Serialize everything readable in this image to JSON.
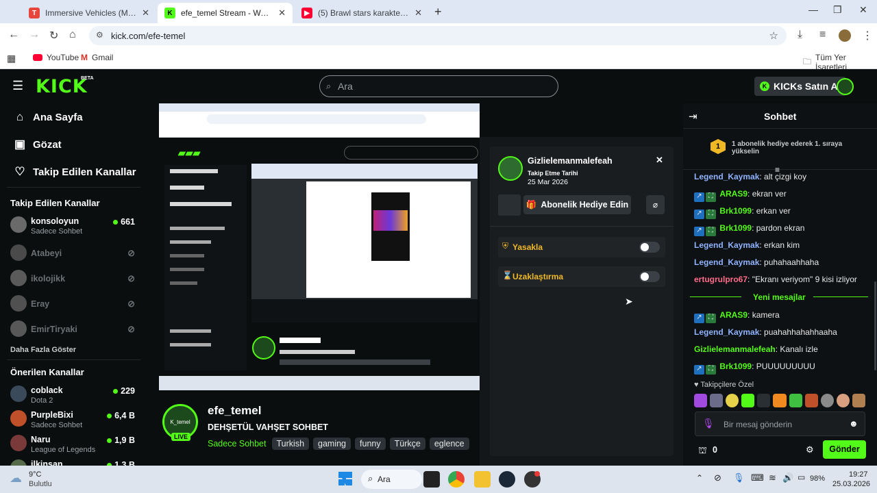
{
  "browser": {
    "tabs": [
      {
        "title": "Immersive Vehicles (MTS/IV) - C",
        "active": false
      },
      {
        "title": "efe_temel Stream - Watch Live o",
        "active": true
      },
      {
        "title": "(5) Brawl stars karakterleriyle şe",
        "active": false
      }
    ],
    "new_tab": "+",
    "url": "kick.com/efe-temel",
    "bookmarks": [
      {
        "label": "YouTube"
      },
      {
        "label": "Gmail"
      }
    ],
    "all_bookmarks": "Tüm Yer İşaretleri"
  },
  "kick": {
    "logo": "KICK",
    "beta": "BETA",
    "search_placeholder": "Ara",
    "buy_kicks": "KICKs Satın Al",
    "nav": [
      {
        "label": "Ana Sayfa",
        "icon": "home-icon"
      },
      {
        "label": "Gözat",
        "icon": "browse-icon"
      },
      {
        "label": "Takip Edilen Kanallar",
        "icon": "heart-icon"
      }
    ],
    "followed_heading": "Takip Edilen Kanallar",
    "followed": [
      {
        "name": "konsoloyun",
        "sub": "Sadece Sohbet",
        "count": "661",
        "live": true
      },
      {
        "name": "Atabeyi",
        "sub": "",
        "count": "",
        "live": false
      },
      {
        "name": "ikolojikk",
        "sub": "",
        "count": "",
        "live": false
      },
      {
        "name": "Eray",
        "sub": "",
        "count": "",
        "live": false
      },
      {
        "name": "EmirTiryaki",
        "sub": "",
        "count": "",
        "live": false
      }
    ],
    "show_more": "Daha Fazla Göster",
    "recommended_heading": "Önerilen Kanallar",
    "recommended": [
      {
        "name": "coblack",
        "sub": "Dota 2",
        "count": "229"
      },
      {
        "name": "PurpleBixi",
        "sub": "Sadece Sohbet",
        "count": "6,4 B"
      },
      {
        "name": "Naru",
        "sub": "League of Legends",
        "count": "1,9 B"
      },
      {
        "name": "ilkinsan",
        "sub": "",
        "count": "1,3 B"
      }
    ]
  },
  "stream": {
    "channel": "efe_temel",
    "avatar_text": "K_temel",
    "live": "LIVE",
    "title": "DEHŞETÜL VAHŞET SOHBET",
    "category": "Sadece Sohbet",
    "tags": [
      "Turkish",
      "gaming",
      "funny",
      "Türkçe",
      "eglence"
    ]
  },
  "user_card": {
    "username": "Gizlielemanmalefeah",
    "follow_label": "Takip Etme Tarihi",
    "follow_date": "25 Mar 2026",
    "gift_button": "Abonelik Hediye Edin",
    "ban_label": "Yasakla",
    "timeout_label": "Uzaklaştırma",
    "close": "✕"
  },
  "chat": {
    "title": "Sohbet",
    "top_gifter_rank": "1",
    "top_gifter_text": "1 abonelik hediye ederek 1. sıraya yükselin",
    "messages": [
      {
        "user": "Legend_Kaymak",
        "color": "#8fb3ff",
        "text": "alt çizgi koy",
        "badges": false
      },
      {
        "user": "ARAS9",
        "color": "#53fc18",
        "text": "ekran ver",
        "badges": true
      },
      {
        "user": "Brk1099",
        "color": "#53fc18",
        "text": "erkan ver",
        "badges": true
      },
      {
        "user": "Brk1099",
        "color": "#53fc18",
        "text": "pardon ekran",
        "badges": true
      },
      {
        "user": "Legend_Kaymak",
        "color": "#8fb3ff",
        "text": "erkan kim",
        "badges": false
      },
      {
        "user": "Legend_Kaymak",
        "color": "#8fb3ff",
        "text": "puhahaahhaha",
        "badges": false
      },
      {
        "user": "ertugrulpro67",
        "color": "#ff6b8a",
        "text": "\"Ekranı veriyom\" 9 kisi izliyor",
        "badges": false
      }
    ],
    "new_messages": "Yeni mesajlar",
    "messages2": [
      {
        "user": "ARAS9",
        "color": "#53fc18",
        "text": "kamera",
        "badges": true
      },
      {
        "user": "Legend_Kaymak",
        "color": "#8fb3ff",
        "text": "puahahhahahhaaha",
        "badges": false
      },
      {
        "user": "Gizlielemanmalefeah",
        "color": "#53fc18",
        "text": "Kanalı izle",
        "badges": false
      },
      {
        "user": "Brk1099",
        "color": "#53fc18",
        "text": "PUUUUUUUUU",
        "badges": true
      }
    ],
    "followers_only": "Takipçilere Özel",
    "input_placeholder": "Bir mesaj gönderin",
    "points": "0",
    "send": "Gönder"
  },
  "taskbar": {
    "temp": "9°C",
    "weather": "Bulutlu",
    "search": "Ara",
    "battery": "98%",
    "time": "19:27",
    "date": "25.03.2026"
  },
  "colors": {
    "kick_green": "#53fc18",
    "bg": "#0b0e0f",
    "chrome_bar": "#dfe7f5"
  }
}
